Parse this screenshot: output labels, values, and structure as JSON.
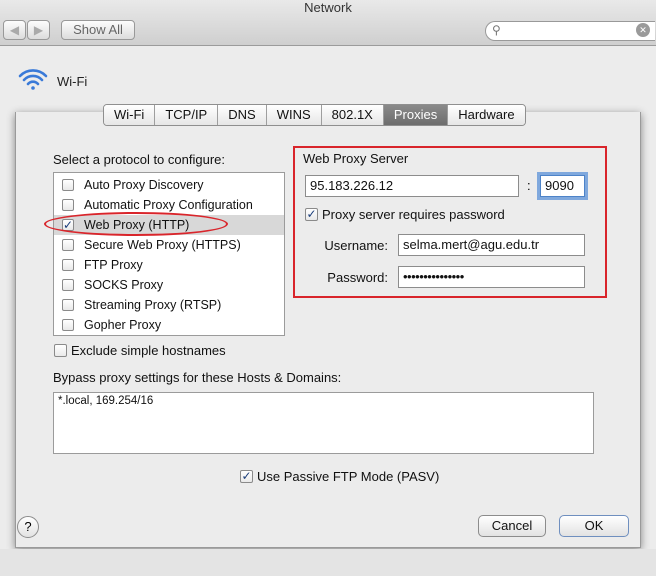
{
  "window": {
    "title": "Network",
    "show_all": "Show All"
  },
  "interface": {
    "name": "Wi-Fi"
  },
  "tabs": [
    {
      "label": "Wi-Fi",
      "active": false
    },
    {
      "label": "TCP/IP",
      "active": false
    },
    {
      "label": "DNS",
      "active": false
    },
    {
      "label": "WINS",
      "active": false
    },
    {
      "label": "802.1X",
      "active": false
    },
    {
      "label": "Proxies",
      "active": true
    },
    {
      "label": "Hardware",
      "active": false
    }
  ],
  "protocols": {
    "heading": "Select a protocol to configure:",
    "items": [
      {
        "label": "Auto Proxy Discovery",
        "checked": false
      },
      {
        "label": "Automatic Proxy Configuration",
        "checked": false
      },
      {
        "label": "Web Proxy (HTTP)",
        "checked": true
      },
      {
        "label": "Secure Web Proxy (HTTPS)",
        "checked": false
      },
      {
        "label": "FTP Proxy",
        "checked": false
      },
      {
        "label": "SOCKS Proxy",
        "checked": false
      },
      {
        "label": "Streaming Proxy (RTSP)",
        "checked": false
      },
      {
        "label": "Gopher Proxy",
        "checked": false
      }
    ]
  },
  "web_proxy": {
    "heading": "Web Proxy Server",
    "server": "95.183.226.12",
    "port": "9090",
    "requires_password_label": "Proxy server requires password",
    "requires_password": true,
    "username_label": "Username:",
    "username": "selma.mert@agu.edu.tr",
    "password_label": "Password:",
    "password": "•••••••••••••••"
  },
  "exclude_simple": {
    "label": "Exclude simple hostnames",
    "checked": false
  },
  "bypass": {
    "label": "Bypass proxy settings for these Hosts & Domains:",
    "value": "*.local, 169.254/16"
  },
  "passive_ftp": {
    "label": "Use Passive FTP Mode (PASV)",
    "checked": true
  },
  "buttons": {
    "help": "?",
    "cancel": "Cancel",
    "ok": "OK"
  },
  "colors": {
    "highlight_red": "#d9252b",
    "focus_ring": "#7fa8dd",
    "active_tab": "#7a7a7a"
  }
}
